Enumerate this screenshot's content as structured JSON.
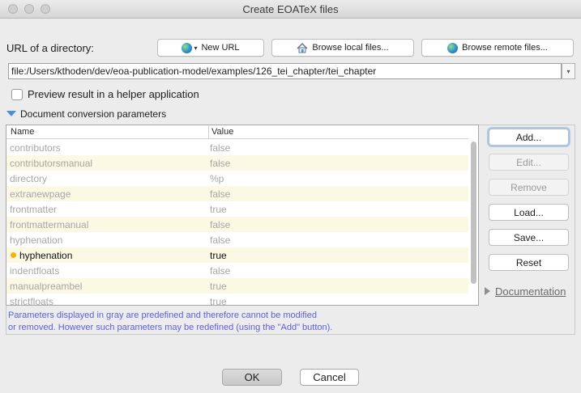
{
  "window": {
    "title": "Create EOATeX files"
  },
  "url_row": {
    "label": "URL of a directory:",
    "new_url_label": "New URL",
    "browse_local_label": "Browse local files...",
    "browse_remote_label": "Browse remote files...",
    "url_value": "file:/Users/kthoden/dev/eoa-publication-model/examples/126_tei_chapter/tei_chapter"
  },
  "preview": {
    "label": "Preview result in a helper application",
    "checked": false
  },
  "params_section": {
    "label": "Document conversion parameters"
  },
  "table": {
    "columns": [
      "Name",
      "Value"
    ],
    "rows": [
      {
        "name": "contributors",
        "value": "false",
        "custom": false
      },
      {
        "name": "contributorsmanual",
        "value": "false",
        "custom": false
      },
      {
        "name": "directory",
        "value": "%p",
        "custom": false
      },
      {
        "name": "extranewpage",
        "value": "false",
        "custom": false
      },
      {
        "name": "frontmatter",
        "value": "true",
        "custom": false
      },
      {
        "name": "frontmattermanual",
        "value": "false",
        "custom": false
      },
      {
        "name": "hyphenation",
        "value": "false",
        "custom": false
      },
      {
        "name": "hyphenation",
        "value": "true",
        "custom": true
      },
      {
        "name": "indentfloats",
        "value": "false",
        "custom": false
      },
      {
        "name": "manualpreambel",
        "value": "true",
        "custom": false
      },
      {
        "name": "strictfloats",
        "value": "true",
        "custom": false
      }
    ]
  },
  "side_buttons": {
    "add": "Add...",
    "edit": "Edit...",
    "remove": "Remove",
    "load": "Load...",
    "save": "Save...",
    "reset": "Reset"
  },
  "documentation": {
    "label": "Documentation"
  },
  "hint": {
    "line1": "Parameters displayed in gray are predefined and therefore cannot be modified",
    "line2": "or removed. However such parameters may be redefined (using the \"Add\" button)."
  },
  "footer": {
    "ok_label": "OK",
    "cancel_label": "Cancel"
  },
  "colors": {
    "hint_text": "#5d5fd8",
    "row_stripe": "#fbf8e3",
    "custom_dot": "#f5b50c",
    "disclosure": "#4a90d9"
  }
}
